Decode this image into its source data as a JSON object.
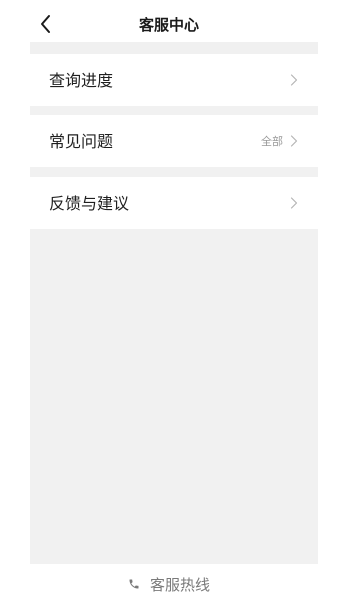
{
  "header": {
    "title": "客服中心",
    "back_icon": "chevron-left-icon"
  },
  "menu": {
    "items": [
      {
        "label": "查询进度",
        "extra": "",
        "icon": "chevron-right-icon"
      },
      {
        "label": "常见问题",
        "extra": "全部",
        "icon": "chevron-right-icon"
      },
      {
        "label": "反馈与建议",
        "extra": "",
        "icon": "chevron-right-icon"
      }
    ]
  },
  "footer": {
    "hotline_label": "客服热线",
    "hotline_icon": "phone-icon"
  },
  "colors": {
    "background": "#ffffff",
    "panel": "#f1f1f1",
    "text_primary": "#1f1f1f",
    "text_secondary": "#999999",
    "hotline_text": "#7a7a7a"
  }
}
